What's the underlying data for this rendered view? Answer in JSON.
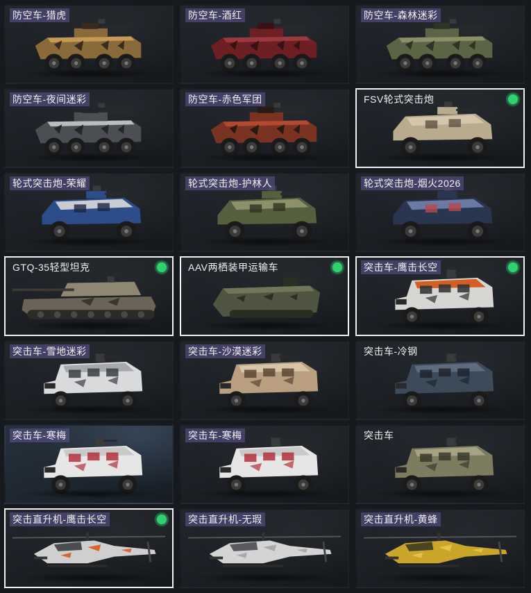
{
  "items": [
    {
      "label": "防空车-猎虎",
      "kind": "aa",
      "colors": [
        "#8a6a3a",
        "#c59a55",
        "#3a2c1c"
      ],
      "selected": false,
      "owned": false,
      "tinted": true
    },
    {
      "label": "防空车-酒红",
      "kind": "aa",
      "colors": [
        "#6e1f24",
        "#9a3a3e",
        "#3b1014"
      ],
      "selected": false,
      "owned": false,
      "tinted": true
    },
    {
      "label": "防空车-森林迷彩",
      "kind": "aa",
      "colors": [
        "#5b6444",
        "#8a8f67",
        "#2f3424"
      ],
      "selected": false,
      "owned": false,
      "tinted": true
    },
    {
      "label": "防空车-夜间迷彩",
      "kind": "aa",
      "colors": [
        "#4b4e53",
        "#b9bcc0",
        "#23262a"
      ],
      "selected": false,
      "owned": false,
      "tinted": true
    },
    {
      "label": "防空车-赤色军团",
      "kind": "aa",
      "colors": [
        "#7a3322",
        "#b24a32",
        "#2a1a14"
      ],
      "selected": false,
      "owned": false,
      "tinted": true
    },
    {
      "label": "FSV轮式突击炮",
      "kind": "fsv",
      "colors": [
        "#b9ab8e",
        "#d3c6aa",
        "#5c5242"
      ],
      "selected": true,
      "owned": true,
      "tinted": false
    },
    {
      "label": "轮式突击炮-荣耀",
      "kind": "fsv",
      "colors": [
        "#2c4c8a",
        "#c9ccd2",
        "#1a2742"
      ],
      "selected": false,
      "owned": false,
      "tinted": true
    },
    {
      "label": "轮式突击炮-护林人",
      "kind": "fsv",
      "colors": [
        "#56603f",
        "#8c916a",
        "#2e3323"
      ],
      "selected": false,
      "owned": false,
      "tinted": true
    },
    {
      "label": "轮式突击炮-烟火2026",
      "kind": "fsv",
      "colors": [
        "#2a3550",
        "#6a7aa2",
        "#b84a4a"
      ],
      "selected": false,
      "owned": false,
      "tinted": true
    },
    {
      "label": "GTQ-35轻型坦克",
      "kind": "tank",
      "colors": [
        "#6b6456",
        "#8f8674",
        "#3a362e"
      ],
      "selected": true,
      "owned": true,
      "tinted": false
    },
    {
      "label": "AAV两栖装甲运输车",
      "kind": "aav",
      "colors": [
        "#4f5540",
        "#6f765a",
        "#2c3024"
      ],
      "selected": true,
      "owned": true,
      "tinted": false
    },
    {
      "label": "突击车-鹰击长空",
      "kind": "mrap",
      "colors": [
        "#d8d6d2",
        "#d35f24",
        "#2c2f33"
      ],
      "selected": true,
      "owned": true,
      "tinted": true
    },
    {
      "label": "突击车-雪地迷彩",
      "kind": "mrap",
      "colors": [
        "#d9dadc",
        "#a7a9ad",
        "#3a3d42"
      ],
      "selected": false,
      "owned": false,
      "tinted": true
    },
    {
      "label": "突击车-沙漠迷彩",
      "kind": "mrap",
      "colors": [
        "#b99f80",
        "#d8c4a8",
        "#5a4634"
      ],
      "selected": false,
      "owned": false,
      "tinted": true
    },
    {
      "label": "突击车-冷钢",
      "kind": "mrap",
      "colors": [
        "#3c4a5a",
        "#5e6d7e",
        "#1e252e"
      ],
      "selected": false,
      "owned": false,
      "tinted": false
    },
    {
      "label": "突击车-寒梅",
      "kind": "mrap",
      "colors": [
        "#e6e6e6",
        "#c9c9c9",
        "#b4303a"
      ],
      "selected": false,
      "owned": false,
      "tinted": true,
      "bg": "blue"
    },
    {
      "label": "突击车-寒梅",
      "kind": "mrap",
      "colors": [
        "#e6e6e6",
        "#c9c9c9",
        "#b4303a"
      ],
      "selected": false,
      "owned": false,
      "tinted": true
    },
    {
      "label": "突击车",
      "kind": "mrap",
      "colors": [
        "#7d7c5e",
        "#a5a384",
        "#3a3a2c"
      ],
      "selected": false,
      "owned": false,
      "tinted": false
    },
    {
      "label": "突击直升机-鹰击长空",
      "kind": "heli",
      "colors": [
        "#cfcfcf",
        "#d9652a",
        "#2a2c30"
      ],
      "selected": true,
      "owned": true,
      "tinted": true
    },
    {
      "label": "突击直升机-无瑕",
      "kind": "heli",
      "colors": [
        "#d4d4d4",
        "#a9a9a9",
        "#3a3c40"
      ],
      "selected": false,
      "owned": false,
      "tinted": true
    },
    {
      "label": "突击直升机-黄蜂",
      "kind": "heli",
      "colors": [
        "#c9a52a",
        "#e5c24a",
        "#2c2a20"
      ],
      "selected": false,
      "owned": false,
      "tinted": true
    }
  ]
}
